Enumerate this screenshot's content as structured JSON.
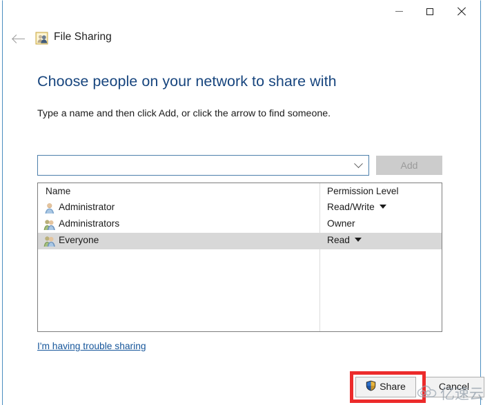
{
  "window": {
    "title": "File Sharing",
    "app_icon": "file-sharing-folder-icon",
    "back_label": "Back",
    "caption": {
      "minimize": "Minimize",
      "maximize": "Maximize",
      "close": "Close"
    }
  },
  "content": {
    "heading": "Choose people on your network to share with",
    "subtext": "Type a name and then click Add, or click the arrow to find someone.",
    "heading_color": "#17457e"
  },
  "add_row": {
    "combo_value": "",
    "combo_placeholder": "",
    "add_label": "Add",
    "add_enabled": false
  },
  "list": {
    "columns": [
      "Name",
      "Permission Level"
    ],
    "rows": [
      {
        "name": "Administrator",
        "permission": "Read/Write",
        "has_dropdown": true,
        "icon": "single-user-icon",
        "selected": false
      },
      {
        "name": "Administrators",
        "permission": "Owner",
        "has_dropdown": false,
        "icon": "user-group-icon",
        "selected": false
      },
      {
        "name": "Everyone",
        "permission": "Read",
        "has_dropdown": true,
        "icon": "user-group-icon",
        "selected": true
      }
    ]
  },
  "links": {
    "trouble": "I'm having trouble sharing"
  },
  "footer": {
    "share_label": "Share",
    "share_icon": "uac-shield-icon",
    "cancel_label": "Cancel",
    "highlight_color": "#ec2b2b"
  },
  "watermark": {
    "text": "亿速云",
    "icon": "cloud-logo-icon"
  }
}
